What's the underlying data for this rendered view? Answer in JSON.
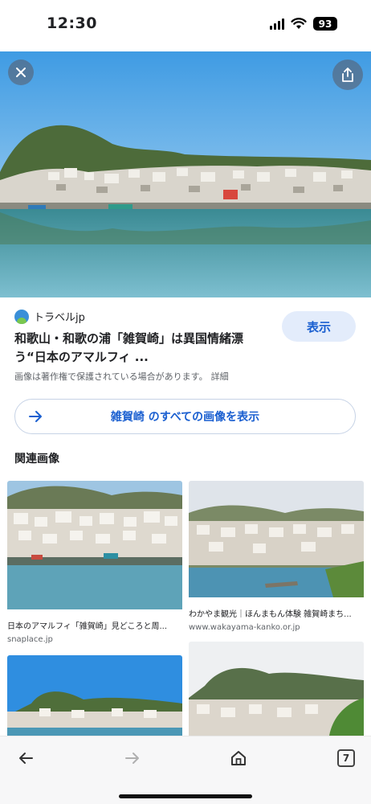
{
  "status_bar": {
    "time": "12:30",
    "battery": "93"
  },
  "result": {
    "source_name": "トラベルjp",
    "title": "和歌山・和歌の浦「雑賀崎」は異国情緒漂う“日本のアマルフィ ...",
    "visit_label": "表示",
    "copyright_notice": "画像は著作権で保護されている場合があります。",
    "detail_label": "詳細",
    "all_images_label": "雑賀崎 のすべての画像を表示"
  },
  "related": {
    "heading": "関連画像",
    "items": [
      {
        "caption": "日本のアマルフィ「雑賀崎」見どころと周...",
        "site": "snaplace.jp"
      },
      {
        "caption": "わかやま観光｜ほんまもん体験 雑賀崎まち...",
        "site": "www.wakayama-kanko.or.jp"
      },
      {
        "caption": "",
        "site": ""
      },
      {
        "caption": "",
        "site": ""
      }
    ]
  },
  "bottom_bar": {
    "tab_count": "7"
  },
  "icons": {
    "close": "close-icon",
    "share": "share-icon",
    "arrow": "arrow-right-icon",
    "back": "back-arrow-icon",
    "forward": "forward-arrow-icon",
    "home": "home-icon",
    "tabs": "tabs-icon"
  },
  "colors": {
    "accent": "#1a5fd0",
    "visit_button_bg": "#e3ecfb"
  }
}
